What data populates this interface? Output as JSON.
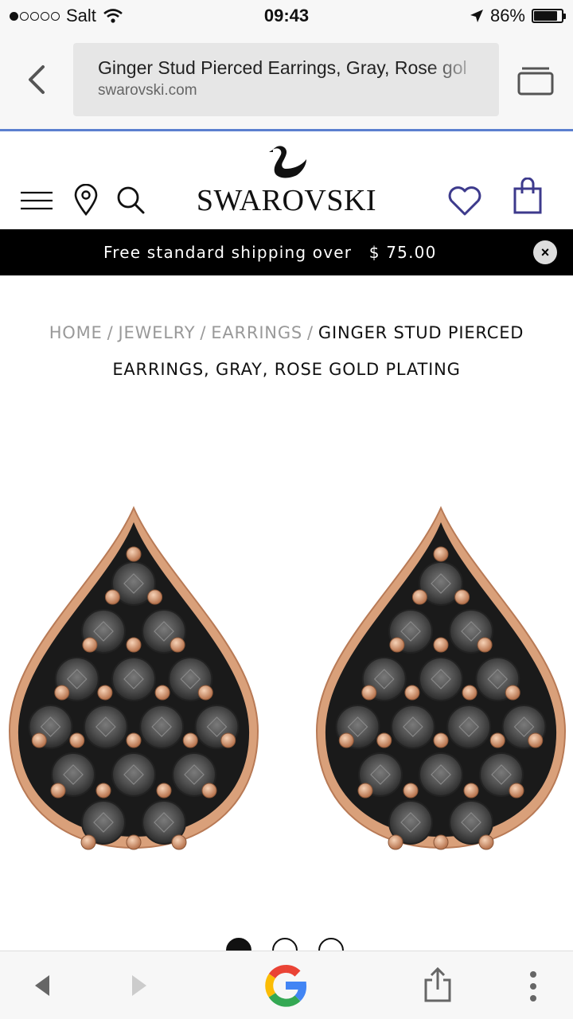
{
  "status_bar": {
    "carrier": "Salt",
    "time": "09:43",
    "battery": "86%",
    "battery_level": 0.86
  },
  "browser": {
    "page_title": "Ginger Stud Pierced Earrings, Gray, Rose gol",
    "host": "swarovski.com"
  },
  "header": {
    "brand": "SWAROVSKI"
  },
  "banner": {
    "text": "Free standard shipping over",
    "amount": "$ 75.00",
    "close_icon": "×"
  },
  "breadcrumb": {
    "items": [
      "HOME",
      "JEWELRY",
      "EARRINGS"
    ],
    "separator": "/",
    "current": "GINGER STUD PIERCED EARRINGS, GRAY, ROSE GOLD PLATING"
  },
  "carousel": {
    "count": 3,
    "active_index": 0
  },
  "colors": {
    "accent": "#5b7fcf",
    "rose_gold": "#d9a07a",
    "crystal_gray": "#4a4a4a",
    "banner_bg": "#000000"
  },
  "icons": {
    "back": "chevron-left-icon",
    "tabs": "tabs-icon",
    "menu": "hamburger-menu-icon",
    "store_locator": "map-pin-icon",
    "search": "search-icon",
    "wishlist": "heart-icon",
    "cart": "shopping-bag-icon",
    "toolbar_back": "toolbar-back-icon",
    "toolbar_forward": "toolbar-forward-icon",
    "google": "google-logo-icon",
    "share": "share-icon",
    "more": "more-vertical-icon"
  }
}
